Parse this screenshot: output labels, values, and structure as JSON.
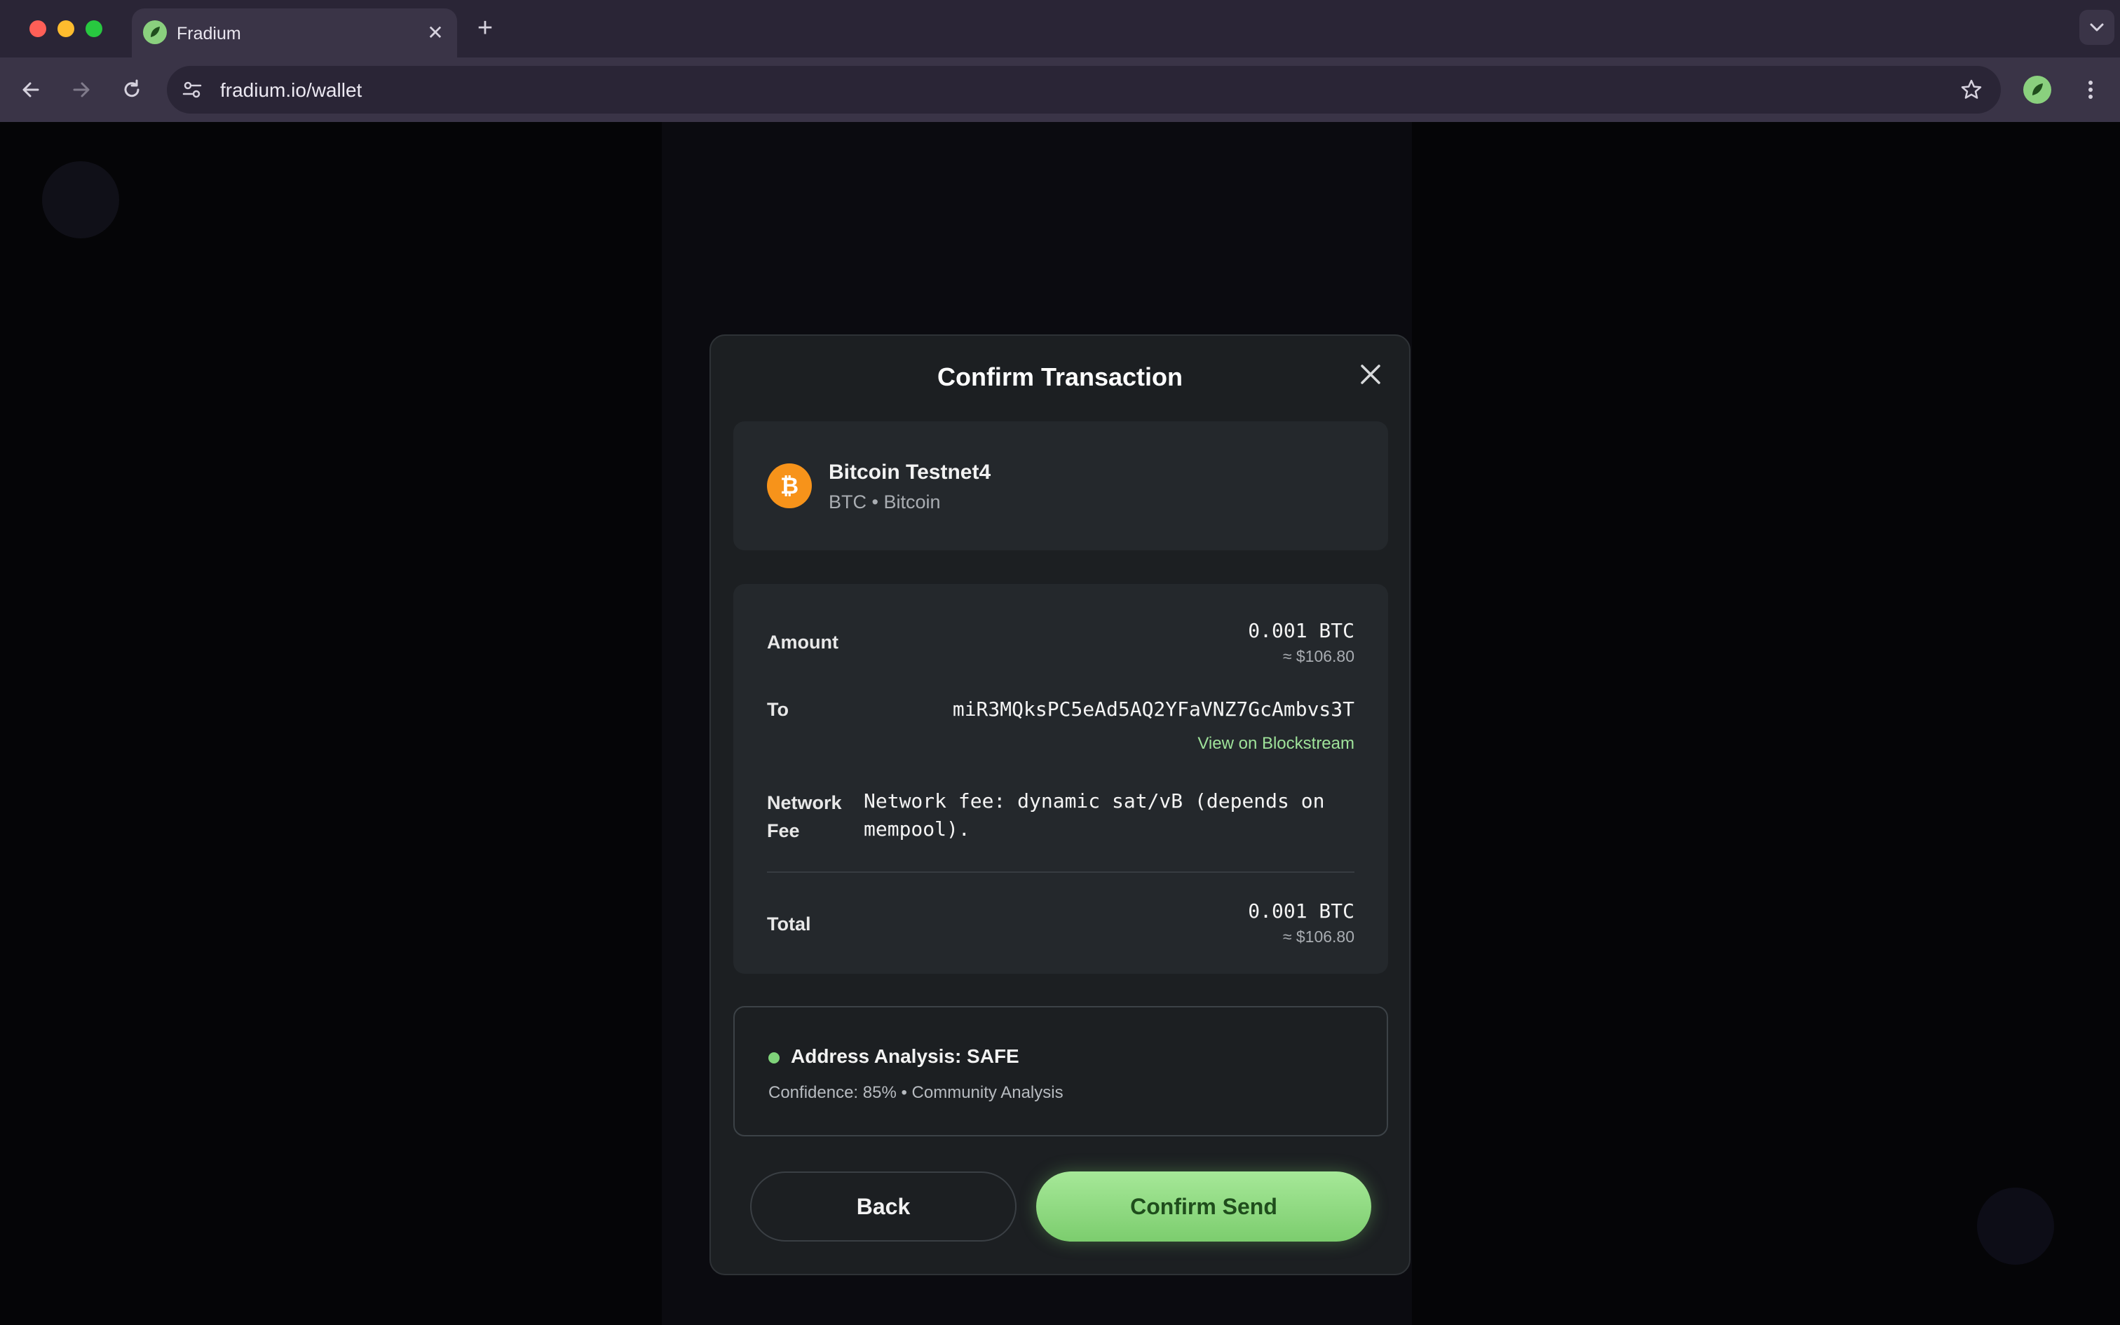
{
  "browser": {
    "tab_title": "Fradium",
    "url": "fradium.io/wallet",
    "new_tab_label": "+",
    "tab_close_label": "✕"
  },
  "modal": {
    "title": "Confirm Transaction",
    "asset": {
      "name": "Bitcoin Testnet4",
      "subtitle": "BTC • Bitcoin"
    },
    "amount": {
      "label": "Amount",
      "value": "0.001 BTC",
      "fiat": "≈ $106.80"
    },
    "to": {
      "label": "To",
      "address": "miR3MQksPC5eAd5AQ2YFaVNZ7GcAmbvs3T",
      "explorer_link": "View on Blockstream"
    },
    "network_fee": {
      "label_line1": "Network",
      "label_line2": "Fee",
      "value": "Network fee: dynamic sat/vB (depends on mempool)."
    },
    "total": {
      "label": "Total",
      "value": "0.001 BTC",
      "fiat": "≈ $106.80"
    },
    "analysis": {
      "title": "Address Analysis: SAFE",
      "detail": "Confidence: 85% • Community Analysis",
      "status_color": "#7fd37a"
    },
    "buttons": {
      "back": "Back",
      "confirm": "Confirm Send"
    }
  },
  "colors": {
    "accent": "#8ad07e",
    "bitcoin": "#f7931a",
    "link": "#9fe39a"
  }
}
